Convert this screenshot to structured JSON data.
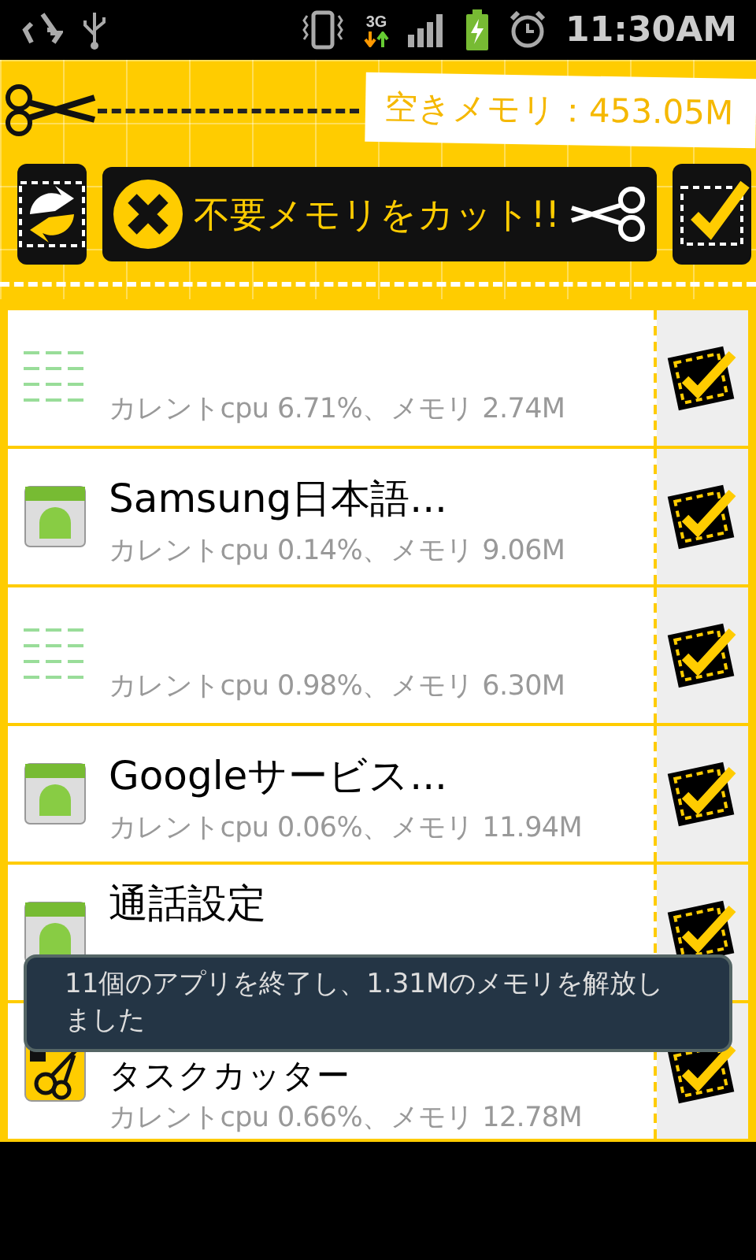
{
  "status_bar": {
    "time": "11:30AM",
    "network": "3G"
  },
  "header": {
    "free_memory": "空きメモリ：453.05M",
    "cut_button": "不要メモリをカット!!"
  },
  "apps": [
    {
      "kind": "fading",
      "detail": "カレントcpu 6.71%、メモリ 2.74M",
      "checked": true
    },
    {
      "kind": "android",
      "name": "Samsung日本語...",
      "detail": "カレントcpu 0.14%、メモリ 9.06M",
      "checked": true
    },
    {
      "kind": "fading",
      "detail": "カレントcpu 0.98%、メモリ 6.30M",
      "checked": true
    },
    {
      "kind": "android",
      "name": "Googleサービス...",
      "detail": "カレントcpu 0.06%、メモリ 11.94M",
      "checked": true
    },
    {
      "kind": "android",
      "name": "通話設定",
      "checked": true
    },
    {
      "kind": "cutter",
      "name": "タスクカッター",
      "detail": "カレントcpu 0.66%、メモリ 12.78M",
      "checked": true
    }
  ],
  "toast": "11個のアプリを終了し、1.31Mのメモリを解放しました"
}
